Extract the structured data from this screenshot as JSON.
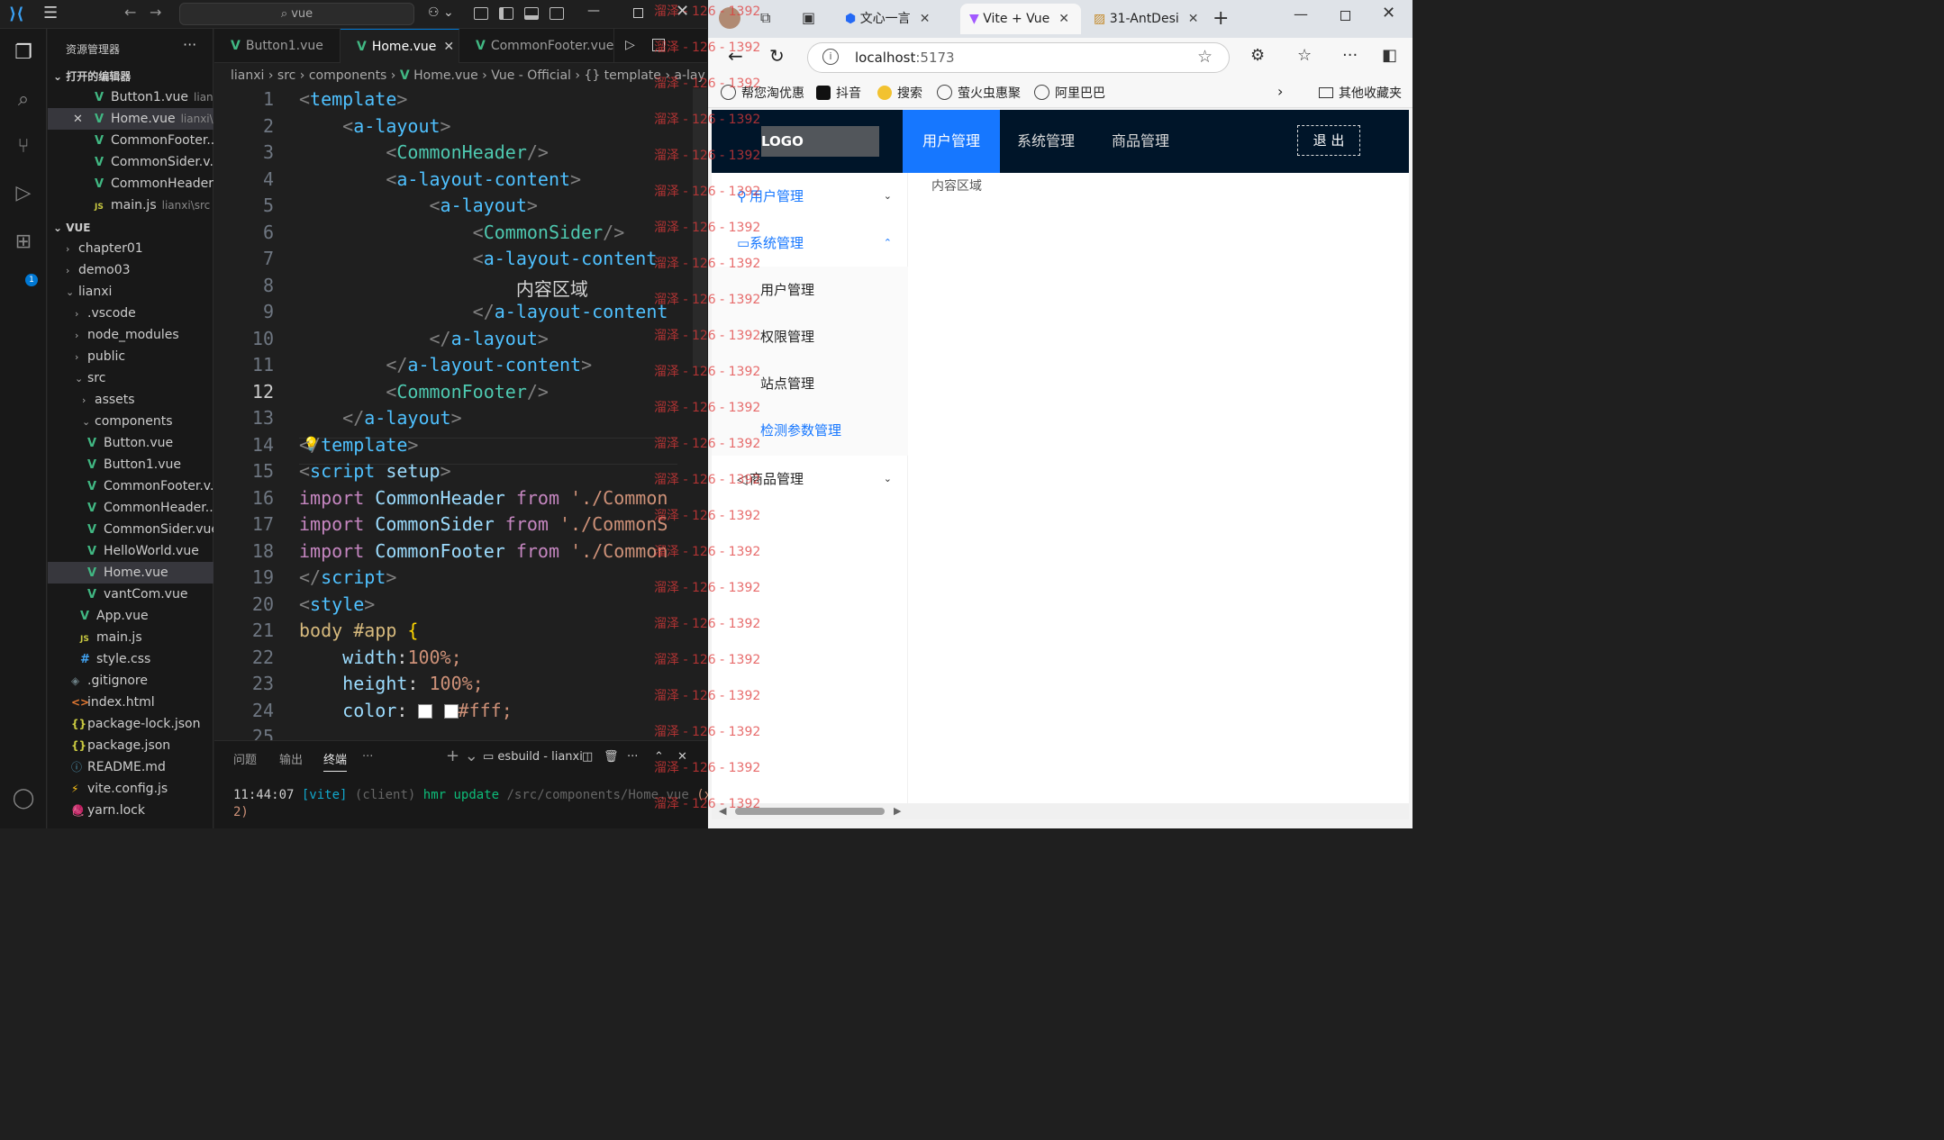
{
  "vscode": {
    "command_center": "vue",
    "sidebar_title": "资源管理器",
    "open_editors_label": "打开的编辑器",
    "open_editors": [
      {
        "name": "Button1.vue",
        "hint": "lian..."
      },
      {
        "name": "Home.vue",
        "hint": "lianxi\\..."
      },
      {
        "name": "CommonFooter...",
        "hint": ""
      },
      {
        "name": "CommonSider.v...",
        "hint": ""
      },
      {
        "name": "CommonHeader...",
        "hint": ""
      },
      {
        "name": "main.js",
        "hint": "lianxi\\src"
      }
    ],
    "workspace_label": "VUE",
    "tree": [
      {
        "label": "chapter01"
      },
      {
        "label": "demo03"
      },
      {
        "label": "lianxi"
      },
      {
        "label": ".vscode"
      },
      {
        "label": "node_modules"
      },
      {
        "label": "public"
      },
      {
        "label": "src"
      },
      {
        "label": "assets"
      },
      {
        "label": "components"
      },
      {
        "label": "Button.vue"
      },
      {
        "label": "Button1.vue"
      },
      {
        "label": "CommonFooter.v..."
      },
      {
        "label": "CommonHeader...."
      },
      {
        "label": "CommonSider.vue"
      },
      {
        "label": "HelloWorld.vue"
      },
      {
        "label": "Home.vue"
      },
      {
        "label": "vantCom.vue"
      },
      {
        "label": "App.vue"
      },
      {
        "label": "main.js"
      },
      {
        "label": "style.css"
      },
      {
        "label": ".gitignore"
      },
      {
        "label": "index.html"
      },
      {
        "label": "package-lock.json"
      },
      {
        "label": "package.json"
      },
      {
        "label": "README.md"
      },
      {
        "label": "vite.config.js"
      },
      {
        "label": "yarn.lock"
      }
    ],
    "extensions_badge": "1",
    "tabs": [
      "Button1.vue",
      "Home.vue",
      "CommonFooter.vue"
    ],
    "breadcrumb": [
      "lianxi",
      "src",
      "components",
      "Home.vue",
      "Vue - Official",
      "{} template",
      "a-lay"
    ],
    "code_lines": [
      "1",
      "2",
      "3",
      "4",
      "5",
      "6",
      "7",
      "8",
      "9",
      "10",
      "11",
      "12",
      "13",
      "14",
      "15",
      "16",
      "17",
      "18",
      "19",
      "20",
      "21",
      "22",
      "23",
      "24",
      "25"
    ],
    "code": {
      "l1": "template",
      "l2": "a-layout",
      "l3": "CommonHeader",
      "l4": "a-layout-content",
      "l5": "a-layout",
      "l6": "CommonSider",
      "l7": "a-layout-content",
      "l8": "内容区域",
      "l9": "a-layout-content",
      "l10": "a-layout",
      "l11": "a-layout-content",
      "l12": "CommonFooter",
      "l13": "a-layout",
      "l14": "template",
      "l15_tag": "script",
      "l15_attr": "setup",
      "import_kw": "import",
      "from_kw": "from",
      "l16_id": "CommonHeader",
      "l16_str": "'./Common",
      "l17_id": "CommonSider",
      "l17_str": "'./CommonS",
      "l18_id": "CommonFooter",
      "l18_str": "'./Common",
      "l19": "script",
      "l20": "style",
      "l21_sel": "body #app",
      "l22_prop": "width",
      "l22_val": "100%;",
      "l23_prop": "height",
      "l23_val": "100%;",
      "l24_prop": "color",
      "l24_val": "#fff;"
    },
    "panel_tabs": [
      "问题",
      "输出",
      "终端"
    ],
    "terminal_name": "esbuild - lianxi",
    "terminal": {
      "time": "11:44:07",
      "vite": "[vite]",
      "client": "(client)",
      "msg": "hmr update",
      "path": "/src/components/Home.vue",
      "suffix": "(x",
      "line2": "2)"
    }
  },
  "browser": {
    "tabs": [
      {
        "title": "文心一言"
      },
      {
        "title": "Vite + Vue"
      },
      {
        "title": "31-AntDesi"
      }
    ],
    "url_host": "localhost",
    "url_port": ":5173",
    "bookmarks": [
      "帮您淘优惠",
      "抖音",
      "搜索",
      "萤火虫惠聚",
      "阿里巴巴"
    ],
    "bookmarks_other": "其他收藏夹"
  },
  "app": {
    "logo": "LOGO",
    "nav": [
      "用户管理",
      "系统管理",
      "商品管理"
    ],
    "logout": "退 出",
    "menu": {
      "user": "用户管理",
      "system": "系统管理",
      "system_sub": [
        "用户管理",
        "权限管理",
        "站点管理",
        "检测参数管理"
      ],
      "goods": "商品管理"
    },
    "content": "内容区域"
  },
  "watermark": "溜泽 - 126 - 1392"
}
